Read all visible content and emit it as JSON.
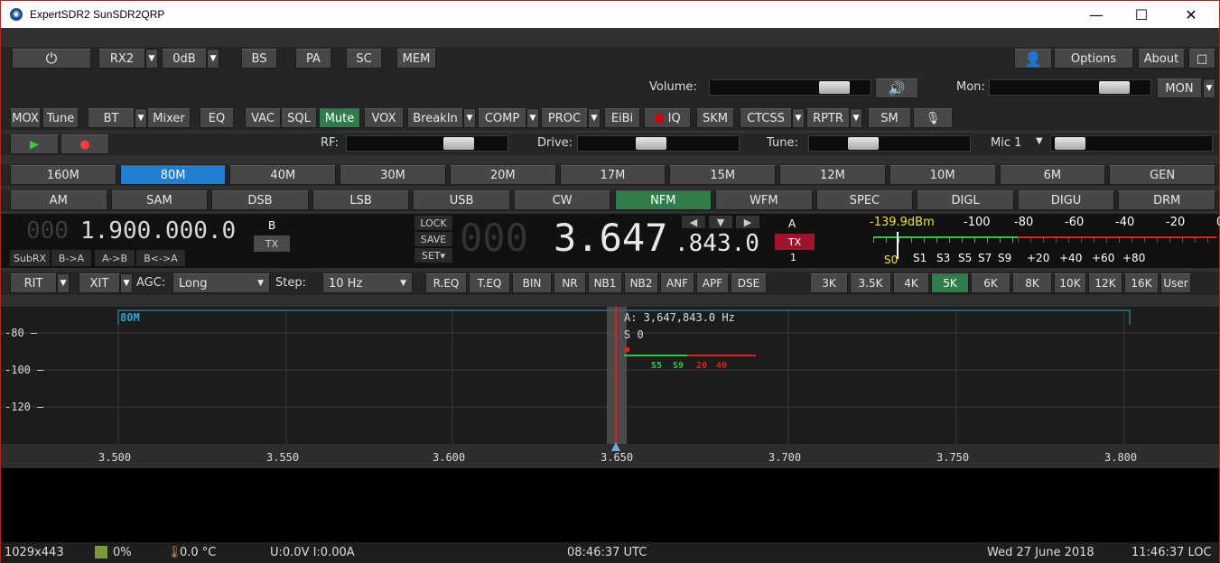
{
  "window": {
    "title": "ExpertSDR2 SunSDR2QRP",
    "minimize": "—",
    "maximize": "☐",
    "close": "✕"
  },
  "toolbar1": {
    "power": "⏻",
    "rx": "RX2",
    "att": "0dB",
    "bs": "BS",
    "pa": "PA",
    "sc": "SC",
    "mem": "MEM",
    "options": "Options",
    "about": "About",
    "restore": "□"
  },
  "volume": {
    "label": "Volume:",
    "speaker": "🔊",
    "mon_label": "Mon:",
    "mon_button": "MON",
    "level": 0.85,
    "mon_level": 0.85
  },
  "controls": {
    "mox": "MOX",
    "tune": "Tune",
    "bt": "BT",
    "mixer": "Mixer",
    "eq": "EQ",
    "vac": "VAC",
    "sql": "SQL",
    "mute": "Mute",
    "vox": "VOX",
    "breakin": "BreakIn",
    "comp": "COMP",
    "proc": "PROC",
    "eibi": "EiBi",
    "iq": "IQ",
    "skm": "SKM",
    "ctcss": "CTCSS",
    "rptr": "RPTR",
    "sm": "SM",
    "mic_icon": "🎙"
  },
  "play": {
    "play": "▶",
    "rec": "●",
    "rf_label": "RF:",
    "drive_label": "Drive:",
    "tune_label": "Tune:",
    "mic_label": "Mic 1",
    "rf_level": 0.75,
    "drive_level": 0.45,
    "tune_level": 0.3
  },
  "bands": [
    "160M",
    "80M",
    "40M",
    "30M",
    "20M",
    "17M",
    "15M",
    "12M",
    "10M",
    "6M",
    "GEN"
  ],
  "active_band": "80M",
  "modes": [
    "AM",
    "SAM",
    "DSB",
    "LSB",
    "USB",
    "CW",
    "NFM",
    "WFM",
    "SPEC",
    "DIGL",
    "DIGU",
    "DRM"
  ],
  "active_mode": "NFM",
  "vfo_b": {
    "digits_dim": "000",
    "freq": "1.900.000.0",
    "label": "B",
    "tx": "TX",
    "subrx": "SubRX",
    "b_a": "B->A",
    "a_b": "A->B",
    "swap": "B<->A"
  },
  "vfo_a": {
    "lock": "LOCK",
    "save": "SAVE",
    "set": "SET▾",
    "digits_dim": "000",
    "freq_main": "3.647",
    "freq_fine": ".843.0",
    "label": "A",
    "tx": "TX",
    "rx_num": "1",
    "nav_left": "◀",
    "nav_down": "▼",
    "nav_right": "▶"
  },
  "smeter": {
    "reading": "-139.9dBm",
    "top_scale": [
      "-100",
      "-80",
      "-60",
      "-40",
      "-20",
      "0"
    ],
    "s_label": "S0",
    "bottom_scale": [
      "S1",
      "S3",
      "S5",
      "S7",
      "S9",
      "+20",
      "+40",
      "+60",
      "+80"
    ]
  },
  "dsp": {
    "rit": "RIT",
    "xit": "XIT",
    "agc_label": "AGC:",
    "agc_value": "Long",
    "step_label": "Step:",
    "step_value": "10 Hz",
    "buttons": [
      "R.EQ",
      "T.EQ",
      "BIN",
      "NR",
      "NB1",
      "NB2",
      "ANF",
      "APF",
      "DSE"
    ],
    "filters": [
      "3K",
      "3.5K",
      "4K",
      "5K",
      "6K",
      "8K",
      "10K",
      "12K",
      "16K",
      "User"
    ],
    "active_filter": "5K"
  },
  "spectrum": {
    "band_label": "80M",
    "vfo_readout": "A: 3,647,843.0 Hz",
    "s_readout": "S 0",
    "db_labels": [
      "-80 —",
      "-100 —",
      "-120 —"
    ],
    "freq_labels": [
      "3.500",
      "3.550",
      "3.600",
      "3.650",
      "3.700",
      "3.750",
      "3.800"
    ],
    "mini_s": [
      "S5",
      "S9",
      "20",
      "40"
    ]
  },
  "status": {
    "resolution": "1029x443",
    "cpu": "0%",
    "temp": "0.0 °C",
    "power": "U:0.0V I:0.00A",
    "utc": "08:46:37 UTC",
    "date": "Wed 27 June 2018",
    "loc": "11:46:37 LOC"
  }
}
